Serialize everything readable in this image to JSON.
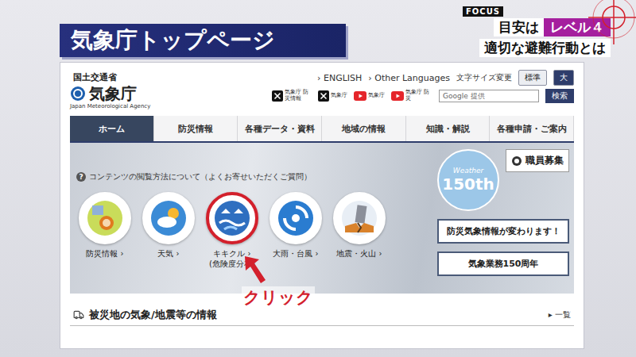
{
  "broadcast": {
    "title": "気象庁トップページ",
    "logo": "FOCUS",
    "headline_prefix": "目安は",
    "headline_badge": "レベル４",
    "subheadline": "適切な避難行動とは"
  },
  "site": {
    "ministry": "国土交通省",
    "name": "気象庁",
    "name_en": "Japan Meteorological Agency",
    "lang_links": [
      {
        "arrow": "›",
        "label": "ENGLISH"
      },
      {
        "arrow": "›",
        "label": "Other Languages"
      }
    ],
    "font_size": {
      "label": "文字サイズ変更",
      "options": [
        {
          "label": "標準",
          "selected": true
        },
        {
          "label": "大",
          "selected": false
        }
      ]
    },
    "social": [
      {
        "kind": "x",
        "label": "気象庁 防災情報"
      },
      {
        "kind": "x",
        "label": "気象庁"
      },
      {
        "kind": "youtube",
        "label": "気象庁"
      },
      {
        "kind": "youtube",
        "label": "気象庁 防災"
      }
    ],
    "search": {
      "placeholder": "Google 提供",
      "button": "検索"
    },
    "nav": [
      {
        "label": "ホーム",
        "selected": true
      },
      {
        "label": "防災情報",
        "selected": false
      },
      {
        "label": "各種データ・資料",
        "selected": false
      },
      {
        "label": "地域の情報",
        "selected": false
      },
      {
        "label": "知識・解説",
        "selected": false
      },
      {
        "label": "各種申請・ご案内",
        "selected": false
      }
    ],
    "hero": {
      "faq_icon": "?",
      "faq": "コンテンツの閲覧方法について（よくお寄せいただくご質問）",
      "icons": [
        {
          "kind": "bousai",
          "label": "防災情報",
          "arrow": "›",
          "sub": "",
          "highlighted": false
        },
        {
          "kind": "weather",
          "label": "天気",
          "arrow": "›",
          "sub": "",
          "highlighted": false
        },
        {
          "kind": "kikikuru",
          "label": "キキクル",
          "arrow": "›",
          "sub": "(危険度分布)",
          "highlighted": true
        },
        {
          "kind": "typhoon",
          "label": "大雨・台風",
          "arrow": "›",
          "sub": "",
          "highlighted": false
        },
        {
          "kind": "quake",
          "label": "地震・火山",
          "arrow": "›",
          "sub": "",
          "highlighted": false
        }
      ],
      "badge": {
        "top": "Weather",
        "main": "150th"
      },
      "jobs": "職員募集",
      "banners": [
        "防災気象情報が変わります！",
        "気象業務150周年"
      ]
    },
    "section": {
      "title": "被災地の気象/地震等の情報",
      "more_arrow": "▸",
      "more": "一覧"
    }
  },
  "annotation": {
    "label": "クリック"
  }
}
